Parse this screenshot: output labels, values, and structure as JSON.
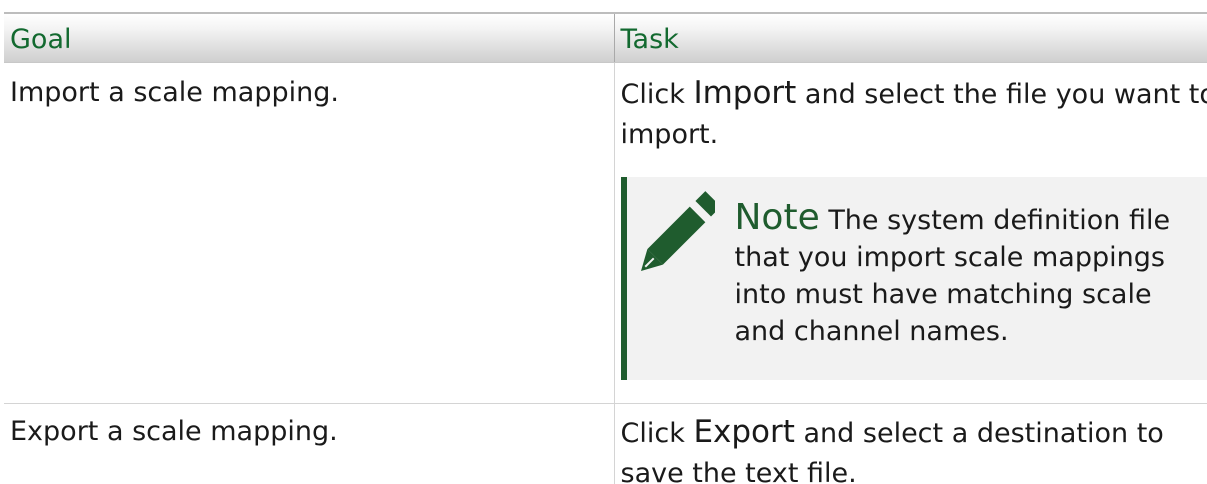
{
  "table": {
    "headers": [
      "Goal",
      "Task"
    ],
    "rows": [
      {
        "goal": "Import a scale mapping.",
        "task_prefix": "Click",
        "task_term": "Import",
        "task_suffix": "and select the file you want to import.",
        "note": {
          "label": "Note",
          "text": "The system definition file that you import scale mappings into must have matching scale and channel names.",
          "icon": "pencil-icon"
        }
      },
      {
        "goal": "Export a scale mapping.",
        "task_prefix": "Click",
        "task_term": "Export",
        "task_suffix": "and select a destination to save the text file."
      }
    ]
  },
  "colors": {
    "header_text": "#12692f",
    "note_accent": "#1f5c2e",
    "note_background": "#f2f2f2"
  }
}
